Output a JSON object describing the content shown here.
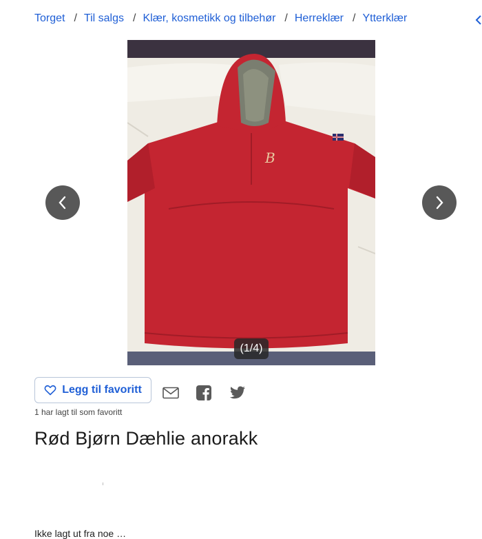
{
  "breadcrumb": {
    "items": [
      "Torget",
      "Til salgs",
      "Klær, kosmetikk og tilbehør",
      "Herreklær",
      "Ytterklær"
    ],
    "separator": "/"
  },
  "gallery": {
    "counter": "(1/4)",
    "prev_icon": "chevron-left-icon",
    "next_icon": "chevron-right-icon",
    "image_subject": "red anorak jacket with fur-trimmed hood on a bed"
  },
  "actions": {
    "favorite_label": "Legg til favoritt",
    "favorite_count_text": "1 har lagt til som favoritt",
    "share_icons": [
      "mail-icon",
      "facebook-icon",
      "twitter-icon"
    ]
  },
  "listing": {
    "title": "Rød Bjørn Dæhlie anorakk",
    "partial_text": "Ikke lagt ut fra noe …"
  },
  "colors": {
    "link": "#1f5fd6",
    "jacket": "#c42531",
    "nav_button": "#4a4a4a"
  }
}
